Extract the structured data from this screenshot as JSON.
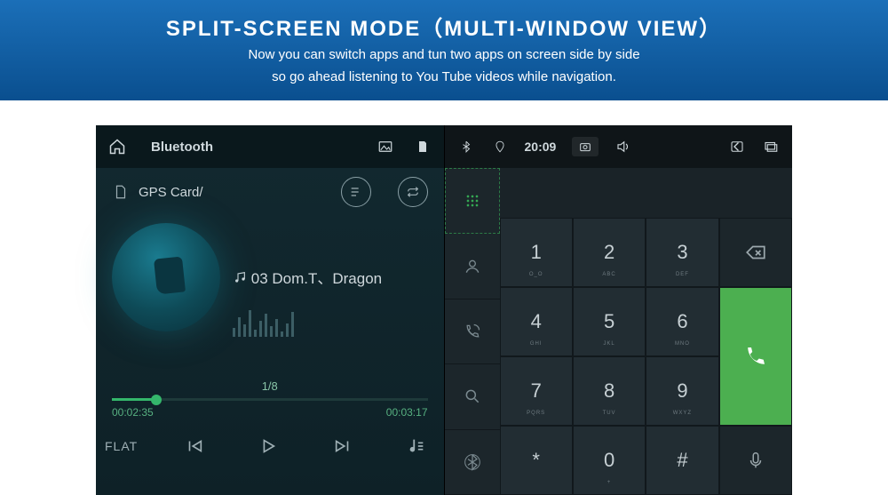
{
  "banner": {
    "title": "SPLIT-SCREEN MODE（MULTI-WINDOW VIEW）",
    "line1": "Now you can switch apps and tun two apps on screen side by side",
    "line2": "so go ahead listening to You Tube videos while navigation."
  },
  "left": {
    "status_title": "Bluetooth",
    "path": "GPS Card/",
    "track_title": "03 Dom.T、Dragon",
    "track_counter": "1/8",
    "elapsed": "00:02:35",
    "duration": "00:03:17",
    "eq_label": "FLAT"
  },
  "right": {
    "clock": "20:09",
    "keys": [
      {
        "d": "1",
        "s": "O_O"
      },
      {
        "d": "2",
        "s": "ABC"
      },
      {
        "d": "3",
        "s": "DEF"
      },
      {
        "d": "4",
        "s": "GHI"
      },
      {
        "d": "5",
        "s": "JKL"
      },
      {
        "d": "6",
        "s": "MNO"
      },
      {
        "d": "7",
        "s": "PQRS"
      },
      {
        "d": "8",
        "s": "TUV"
      },
      {
        "d": "9",
        "s": "WXYZ"
      },
      {
        "d": "*",
        "s": ""
      },
      {
        "d": "0",
        "s": "+"
      },
      {
        "d": "#",
        "s": ""
      }
    ]
  }
}
